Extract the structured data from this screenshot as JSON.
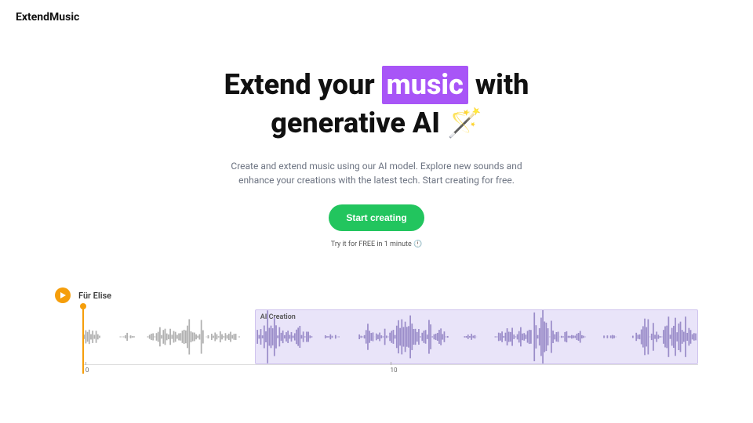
{
  "header": {
    "logo": "ExtendMusic"
  },
  "hero": {
    "title_before": "Extend your ",
    "title_highlight": "music",
    "title_mid": " with generative AI ",
    "title_emoji": "🪄",
    "subtitle": "Create and extend music using our AI model. Explore new sounds and enhance your creations with the latest tech. Start creating for free.",
    "cta_label": "Start creating",
    "cta_note": "Try it for FREE in 1 minute 🕛"
  },
  "track": {
    "name": "Für Elise",
    "ai_label": "AI Creation",
    "ticks": [
      "0",
      "10"
    ],
    "colors": {
      "orig_wave": "#b0b0b0",
      "ai_wave": "#9a8cc9"
    }
  }
}
